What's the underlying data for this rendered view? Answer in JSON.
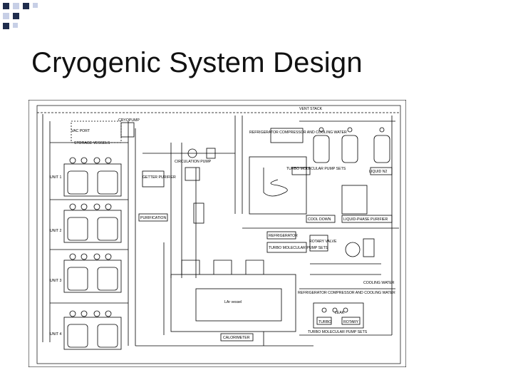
{
  "slide": {
    "title": "Cryogenic System Design"
  },
  "diagram": {
    "labels": {
      "vac_port": "VAC PORT",
      "storage_vessels": "STORAGE VESSELS",
      "cryopump": "CRYOPUMP",
      "circulation_pump": "CIRCULATION PUMP",
      "getter_purifier": "GETTER PURIFIER",
      "purification": "PURIFICATION",
      "refrigerator_compressor": "REFRIGERATOR COMPRESSOR AND COOLING WATER",
      "turbo_pump_sets_top": "TURBO MOLECULAR PUMP SETS",
      "liquid_n2": "LIQUID N2",
      "liquid_phase_purifier": "LIQUID-PHASE PURIFIER",
      "cool_down": "COOL DOWN",
      "refrigerator": "REFRIGERATOR",
      "turbo_pump_sets_mid": "TURBO MOLECULAR PUMP SETS",
      "rotary_valve": "ROTARY VALVE",
      "unit_1": "UNIT 1",
      "unit_2": "UNIT 2",
      "unit_3": "UNIT 3",
      "unit_4": "UNIT 4",
      "vessel_body": "LAr vessel",
      "cooling_water": "COOLING WATER",
      "refrig_compressor_bottom": "REFRIGERATOR COMPRESSOR AND COOLING WATER",
      "leak": "LEAK",
      "turbo": "TURBO",
      "rotary": "ROTARY",
      "turbo_pump_sets_bottom": "TURBO MOLECULAR PUMP SETS",
      "calorimeter": "CALORIMETER",
      "vent_stack": "VENT STACK"
    }
  }
}
